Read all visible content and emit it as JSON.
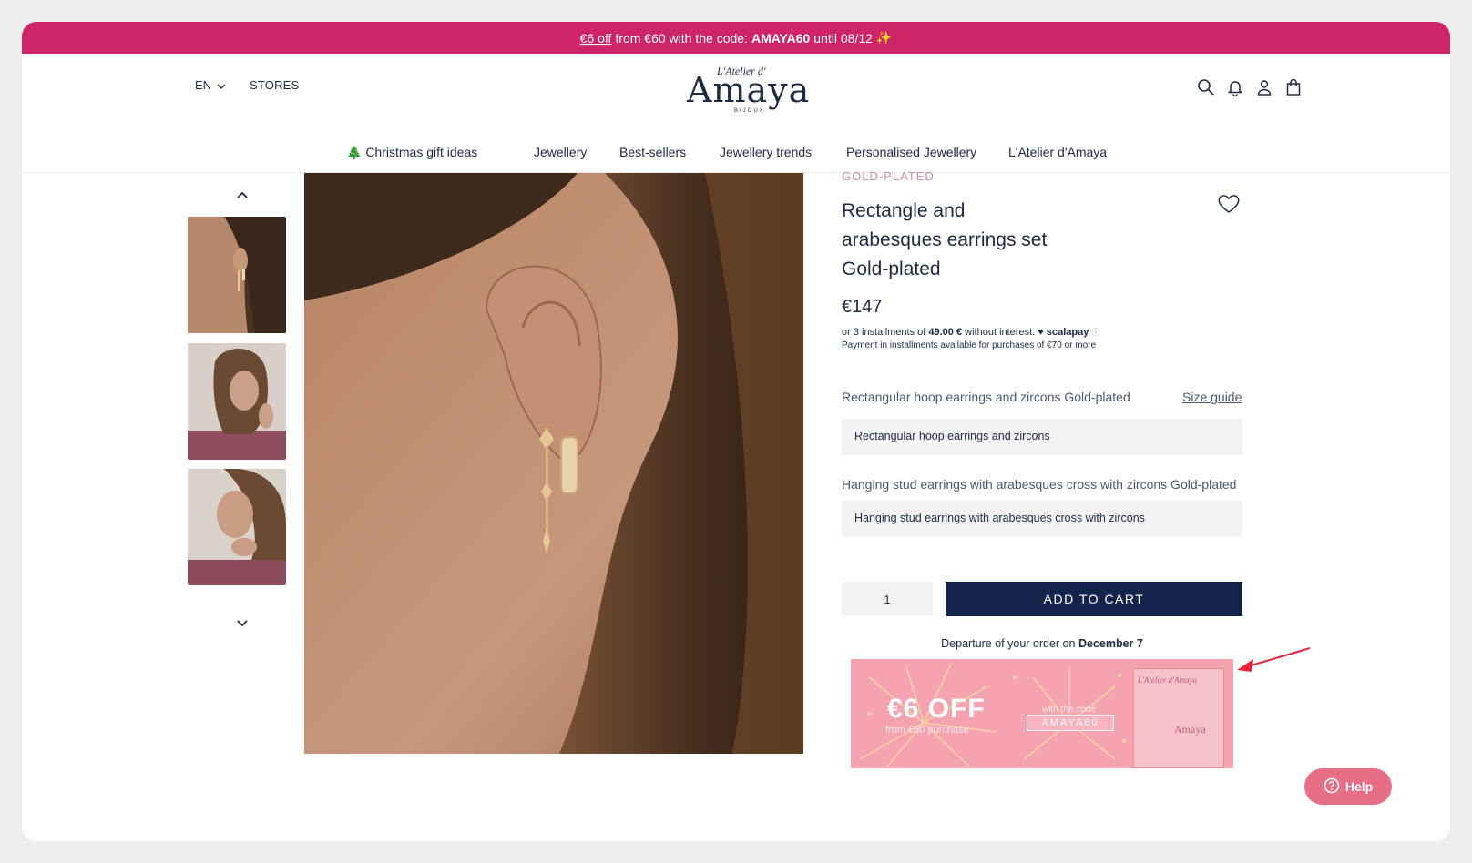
{
  "promo": {
    "link_text": "€6 off",
    "text_middle": "from €60 with the code:",
    "code": "AMAYA60",
    "text_end": "until 08/12",
    "sparkle": "✨"
  },
  "header": {
    "language": "EN",
    "stores": "STORES",
    "logo_small": "L'Atelier d'",
    "logo_big": "Amaya",
    "logo_sub": "BIJOUX",
    "icons": [
      "search-icon",
      "bell-icon",
      "user-icon",
      "bag-icon"
    ]
  },
  "nav": {
    "items": [
      {
        "label": "🎄 Christmas gift ideas"
      },
      {
        "label": "Jewellery"
      },
      {
        "label": "Best-sellers"
      },
      {
        "label": "Jewellery trends"
      },
      {
        "label": "Personalised Jewellery"
      },
      {
        "label": "L'Atelier d'Amaya"
      }
    ]
  },
  "product": {
    "category": "GOLD-PLATED",
    "title_line1": "Rectangle and",
    "title_line2": "arabesques earrings set",
    "title_line3": "Gold-plated",
    "price": "€147",
    "installments_prefix": "or 3 installments of",
    "installments_amount": "49.00 €",
    "installments_suffix": "without interest.",
    "installments_brand": "♥ scalapay",
    "installments_note": "Payment in installments available for purchases of €70 or more",
    "option1_label": "Rectangular hoop earrings and zircons Gold-plated",
    "size_guide": "Size guide",
    "option1_value": "Rectangular hoop earrings and zircons",
    "option2_label": "Hanging stud earrings with arabesques cross with zircons Gold-plated",
    "option2_value": "Hanging stud earrings with arabesques cross with zircons",
    "quantity": "1",
    "add_to_cart": "ADD TO CART",
    "departure_prefix": "Departure of your order on",
    "departure_date": "December 7"
  },
  "banner": {
    "headline": "€6 OFF",
    "subline": "from €60 purchase",
    "with_code": "with the code",
    "code": "AMAYA60",
    "shop_sign": "L'Atelier d'Amaya",
    "shop_name": "Amaya"
  },
  "help": {
    "label": "Help"
  },
  "colors": {
    "promo_bar": "#cf2467",
    "brand_navy": "#13234a",
    "banner_pink": "#f5a3b0",
    "help_button": "#e76e87",
    "annotation_arrow": "#e8243c"
  }
}
